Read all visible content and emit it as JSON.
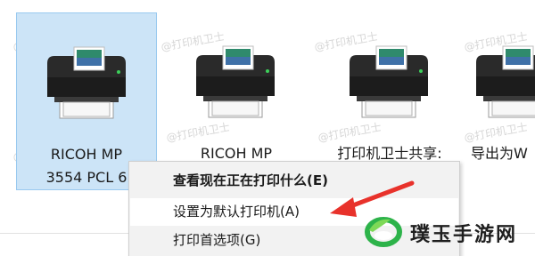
{
  "watermark": {
    "text": "@打印机卫士"
  },
  "devices": [
    {
      "label_line1": "RICOH MP",
      "label_line2": "3554 PCL 6",
      "selected": true,
      "icon": "printer-icon"
    },
    {
      "label_line1": "RICOH MP",
      "label_line2": "",
      "selected": false,
      "icon": "printer-icon"
    },
    {
      "label_line1": "打印机卫士共享:",
      "label_line2": "",
      "selected": false,
      "icon": "printer-icon"
    },
    {
      "label_line1": "导出为W",
      "label_line2": "",
      "selected": false,
      "icon": "printer-icon"
    }
  ],
  "context_menu": {
    "items": [
      {
        "label": "查看现在正在打印什么(E)",
        "bold": true,
        "hover": false
      },
      {
        "label": "设置为默认打印机(A)",
        "bold": false,
        "hover": true
      },
      {
        "label": "打印首选项(G)",
        "bold": false,
        "hover": false
      }
    ]
  },
  "annotation": {
    "arrow_color": "#e8322b"
  },
  "brand": {
    "name": "璞玉手游网",
    "logo_icon": "leaf-ring-logo-icon",
    "color": "#2db34a"
  }
}
